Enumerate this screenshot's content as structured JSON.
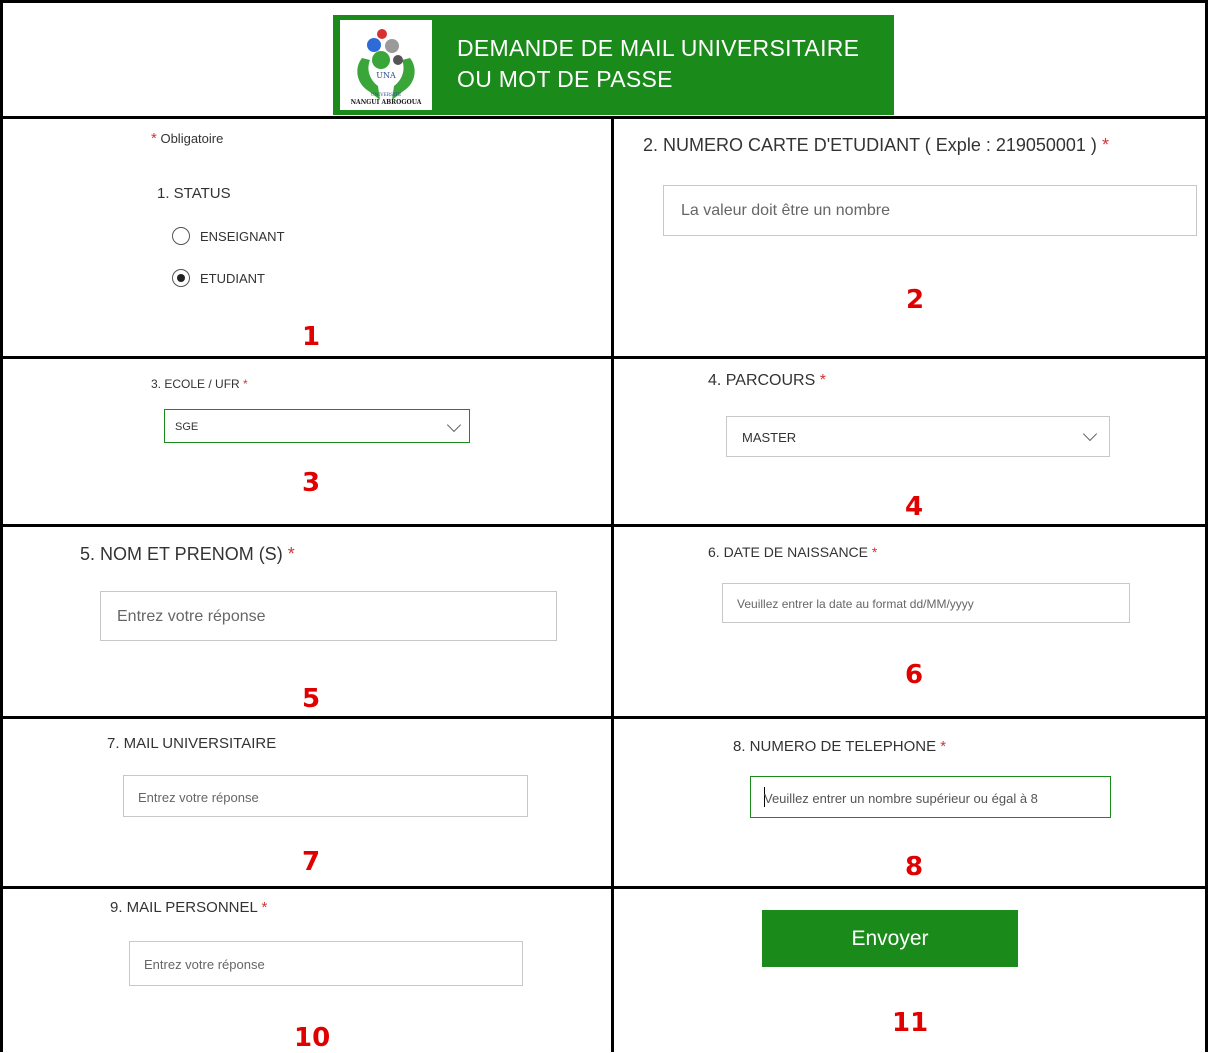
{
  "header": {
    "title_line1": "DEMANDE DE MAIL UNIVERSITAIRE",
    "title_line2": "OU MOT DE PASSE",
    "logo": {
      "text_una": "UNA",
      "text_universite": "UNIVERSITE",
      "text_name": "NANGUI ABROGOUA"
    }
  },
  "required_marker": "*",
  "required_note": "Obligatoire",
  "fields": {
    "status": {
      "label": "1. STATUS",
      "options": [
        {
          "label": "ENSEIGNANT",
          "checked": false
        },
        {
          "label": "ETUDIANT",
          "checked": true
        }
      ]
    },
    "student_card": {
      "label": "2. NUMERO CARTE D'ETUDIANT ( Exple : 219050001 )",
      "placeholder": "La valeur doit être un nombre"
    },
    "school": {
      "label": "3. ECOLE / UFR",
      "value": "SGE"
    },
    "course": {
      "label": "4. PARCOURS",
      "value": "MASTER"
    },
    "name": {
      "label": "5. NOM ET PRENOM (S)",
      "placeholder": "Entrez votre réponse"
    },
    "birthdate": {
      "label": "6. DATE DE NAISSANCE",
      "placeholder": "Veuillez entrer la date au format dd/MM/yyyy"
    },
    "univ_mail": {
      "label": "7. MAIL UNIVERSITAIRE",
      "placeholder": "Entrez votre réponse"
    },
    "phone": {
      "label": "8. NUMERO DE TELEPHONE",
      "placeholder": "Veuillez entrer un nombre supérieur ou égal à 8"
    },
    "personal_mail": {
      "label": "9. MAIL PERSONNEL",
      "placeholder": "Entrez votre réponse"
    }
  },
  "submit_label": "Envoyer",
  "annotations": [
    "1",
    "2",
    "3",
    "4",
    "5",
    "6",
    "7",
    "8",
    "10",
    "11"
  ],
  "colors": {
    "brand_green": "#1a8a1a",
    "annotation_red": "#e00000",
    "required_red": "#d13438"
  }
}
